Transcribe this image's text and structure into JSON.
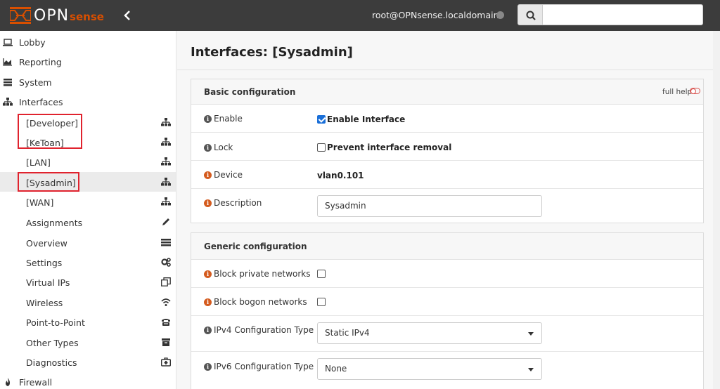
{
  "header": {
    "logo_text": "OPN",
    "logo_suffix": "sense",
    "user": "root@OPNsense.localdomain",
    "search_placeholder": ""
  },
  "sidebar": {
    "top_items": [
      {
        "label": "Lobby",
        "icon": "laptop-icon"
      },
      {
        "label": "Reporting",
        "icon": "area-chart-icon"
      },
      {
        "label": "System",
        "icon": "server-icon"
      },
      {
        "label": "Interfaces",
        "icon": "sitemap-icon"
      }
    ],
    "interface_items": [
      {
        "label": "[Developer]",
        "icon": "sitemap-icon"
      },
      {
        "label": "[KeToan]",
        "icon": "sitemap-icon"
      },
      {
        "label": "[LAN]",
        "icon": "sitemap-icon"
      },
      {
        "label": "[Sysadmin]",
        "icon": "sitemap-icon",
        "active": true
      },
      {
        "label": "[WAN]",
        "icon": "sitemap-icon"
      },
      {
        "label": "Assignments",
        "icon": "pencil-icon"
      },
      {
        "label": "Overview",
        "icon": "tasks-icon"
      },
      {
        "label": "Settings",
        "icon": "cogs-icon"
      },
      {
        "label": "Virtual IPs",
        "icon": "clone-icon"
      },
      {
        "label": "Wireless",
        "icon": "wifi-icon"
      },
      {
        "label": "Point-to-Point",
        "icon": "fax-icon"
      },
      {
        "label": "Other Types",
        "icon": "archive-icon"
      },
      {
        "label": "Diagnostics",
        "icon": "medkit-icon"
      }
    ],
    "bottom_items": [
      {
        "label": "Firewall",
        "icon": "fire-icon"
      }
    ]
  },
  "main": {
    "title": "Interfaces: [Sysadmin]",
    "basic": {
      "heading": "Basic configuration",
      "full_help": "full help",
      "enable_label": "Enable",
      "enable_value": "Enable Interface",
      "enable_checked": true,
      "lock_label": "Lock",
      "lock_value": "Prevent interface removal",
      "lock_checked": false,
      "device_label": "Device",
      "device_value": "vlan0.101",
      "description_label": "Description",
      "description_value": "Sysadmin"
    },
    "generic": {
      "heading": "Generic configuration",
      "block_private_label": "Block private networks",
      "block_private_checked": false,
      "block_bogon_label": "Block bogon networks",
      "block_bogon_checked": false,
      "ipv4_label": "IPv4 Configuration Type",
      "ipv4_value": "Static IPv4",
      "ipv6_label": "IPv6 Configuration Type",
      "ipv6_value": "None"
    }
  },
  "colors": {
    "topbar": "#3c3c3c",
    "brand_orange": "#d94f00",
    "highlight_box": "#e0232e",
    "checkbox_checked": "#1a6fd8",
    "info_orange": "#d45b1e"
  }
}
